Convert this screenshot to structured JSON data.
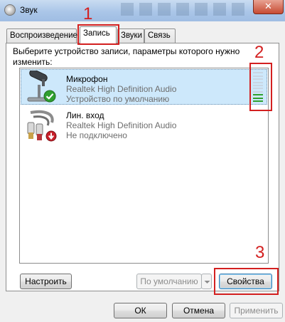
{
  "window": {
    "title": "Звук",
    "close_glyph": "✕"
  },
  "tabs": [
    {
      "label": "Воспроизведение"
    },
    {
      "label": "Запись"
    },
    {
      "label": "Звуки"
    },
    {
      "label": "Связь"
    }
  ],
  "instruction": "Выберите устройство записи, параметры которого нужно изменить:",
  "devices": [
    {
      "name": "Микрофон",
      "driver": "Realtek High Definition Audio",
      "status": "Устройство по умолчанию",
      "icon": "microphone-icon",
      "badge": "default-check-icon",
      "selected": true
    },
    {
      "name": "Лин. вход",
      "driver": "Realtek High Definition Audio",
      "status": "Не подключено",
      "icon": "line-in-cable-icon",
      "badge": "not-connected-down-arrow-icon",
      "selected": false
    }
  ],
  "level_meter": {
    "segments": 10,
    "active_segments": 3,
    "active_color": "#2fa12f",
    "inactive_color": "#c9d6e3"
  },
  "buttons": {
    "configure": "Настроить",
    "set_default": "По умолчанию",
    "properties": "Свойства",
    "ok": "ОК",
    "cancel": "Отмена",
    "apply": "Применить"
  },
  "annotations": {
    "n1": "1",
    "n2": "2",
    "n3": "3",
    "color": "#d32020"
  }
}
